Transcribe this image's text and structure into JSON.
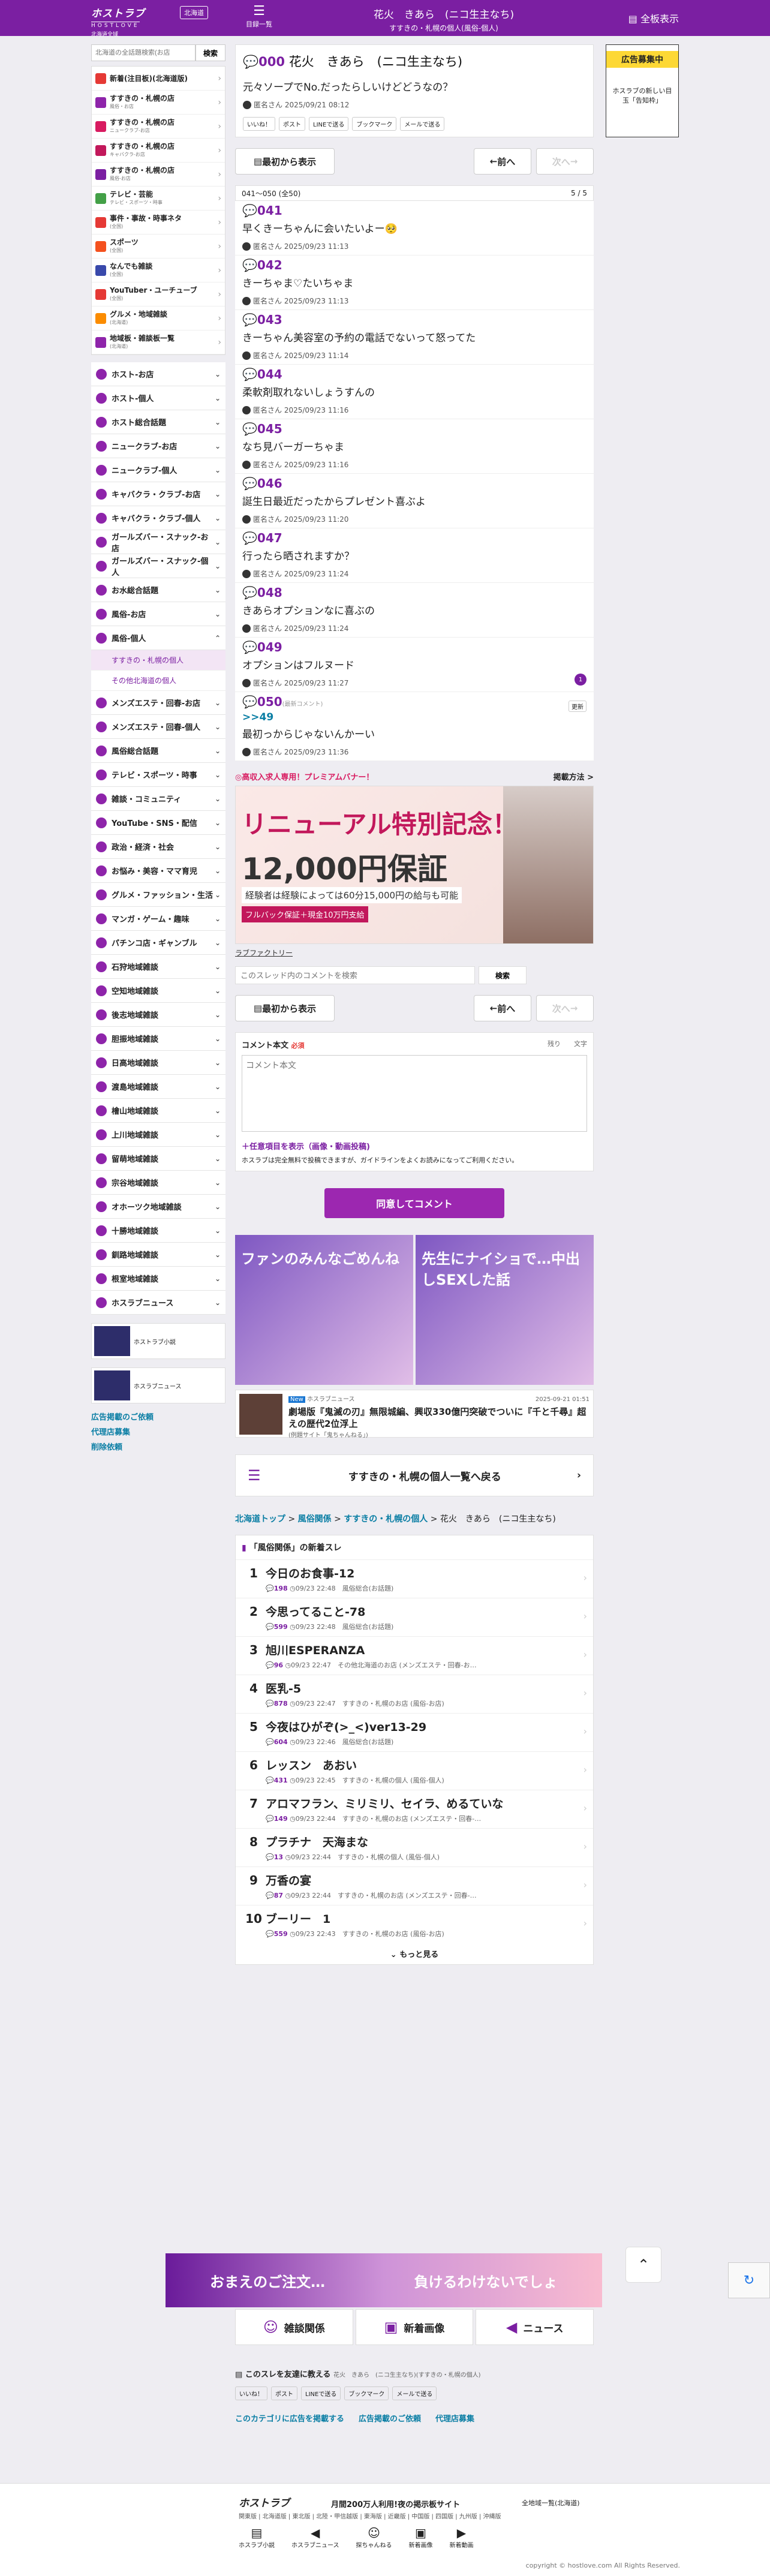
{
  "header": {
    "logo_main": "ホストラブ",
    "logo_sub": "HOSTLOVE",
    "logo_region": "北海道全域",
    "region_button": "北海道",
    "board_list": "目録一覧",
    "title": "花火　きあら　(ニコ生主なち)",
    "subtitle": "すすきの・札幌の個人(風俗-個人)",
    "all_show": "全板表示"
  },
  "sidebar": {
    "search_placeholder": "北海道の全話題検索(お店",
    "search_button": "検索",
    "categories": [
      {
        "label": "新着(注目板)(北海道版)",
        "sub": "",
        "color": "#e53935"
      },
      {
        "label": "すすきの・札幌の店",
        "sub": "風俗・お店",
        "color": "#8e24aa"
      },
      {
        "label": "すすきの・札幌の店",
        "sub": "ニュークラブ-お店",
        "color": "#d81b60"
      },
      {
        "label": "すすきの・札幌の店",
        "sub": "キャバクラ-お店",
        "color": "#c2185b"
      },
      {
        "label": "すすきの・札幌の店",
        "sub": "風俗-お店",
        "color": "#7b1fa2"
      },
      {
        "label": "テレビ・芸能",
        "sub": "テレビ・スポーツ・時事",
        "color": "#43a047"
      },
      {
        "label": "事件・事故・時事ネタ",
        "sub": "(全国)",
        "color": "#e53935"
      },
      {
        "label": "スポーツ",
        "sub": "(全国)",
        "color": "#f4511e"
      },
      {
        "label": "なんでも雑談",
        "sub": "(全国)",
        "color": "#3949ab"
      },
      {
        "label": "YouTuber・ユーチューブ",
        "sub": "(全国)",
        "color": "#e53935"
      },
      {
        "label": "グルメ・地域雑談",
        "sub": "(北海道)",
        "color": "#fb8c00"
      },
      {
        "label": "地域板・雑談板一覧",
        "sub": "(北海道)",
        "color": "#8e24aa"
      }
    ],
    "nav": [
      {
        "label": "ホスト-お店",
        "count": "⌄"
      },
      {
        "label": "ホスト-個人",
        "count": "⌄"
      },
      {
        "label": "ホスト総合話題",
        "count": "⌄"
      },
      {
        "label": "ニュークラブ-お店",
        "count": "⌄"
      },
      {
        "label": "ニュークラブ-個人",
        "count": "⌄"
      },
      {
        "label": "キャバクラ・クラブ-お店",
        "count": "⌄"
      },
      {
        "label": "キャバクラ・クラブ-個人",
        "count": "⌄"
      },
      {
        "label": "ガールズバー・スナック-お店",
        "count": "⌄"
      },
      {
        "label": "ガールズバー・スナック-個人",
        "count": "⌄"
      },
      {
        "label": "お水総合話題",
        "count": "⌄"
      },
      {
        "label": "風俗-お店",
        "count": "⌄"
      },
      {
        "label": "風俗-個人",
        "count": "⌃"
      }
    ],
    "nav_sub": [
      "すすきの・札幌の個人",
      "その他北海道の個人"
    ],
    "nav2": [
      {
        "label": "メンズエステ・回春-お店",
        "count": "⌄"
      },
      {
        "label": "メンズエステ・回春-個人",
        "count": "⌄"
      },
      {
        "label": "風俗総合話題",
        "count": "⌄"
      },
      {
        "label": "テレビ・スポーツ・時事",
        "count": "⌄"
      },
      {
        "label": "雑談・コミュニティ",
        "count": "⌄"
      },
      {
        "label": "YouTube・SNS・配信",
        "count": "⌄"
      },
      {
        "label": "政治・経済・社会",
        "count": "⌄"
      },
      {
        "label": "お悩み・美容・ママ育児",
        "count": "⌄"
      },
      {
        "label": "グルメ・ファッション・生活",
        "count": "⌄"
      },
      {
        "label": "マンガ・ゲーム・趣味",
        "count": "⌄"
      },
      {
        "label": "パチンコ店・ギャンブル",
        "count": "⌄"
      },
      {
        "label": "石狩地域雑談",
        "count": "⌄"
      },
      {
        "label": "空知地域雑談",
        "count": "⌄"
      },
      {
        "label": "後志地域雑談",
        "count": "⌄"
      },
      {
        "label": "胆振地域雑談",
        "count": "⌄"
      },
      {
        "label": "日高地域雑談",
        "count": "⌄"
      },
      {
        "label": "渡島地域雑談",
        "count": "⌄"
      },
      {
        "label": "檜山地域雑談",
        "count": "⌄"
      },
      {
        "label": "上川地域雑談",
        "count": "⌄"
      },
      {
        "label": "留萌地域雑談",
        "count": "⌄"
      },
      {
        "label": "宗谷地域雑談",
        "count": "⌄"
      },
      {
        "label": "オホーツク地域雑談",
        "count": "⌄"
      },
      {
        "label": "十勝地域雑談",
        "count": "⌄"
      },
      {
        "label": "釧路地域雑談",
        "count": "⌄"
      },
      {
        "label": "根室地域雑談",
        "count": "⌄"
      },
      {
        "label": "ホスラブニュース",
        "count": "⌄"
      }
    ],
    "banner1": "ホストラブ小説",
    "banner2": "ホスラブニュース",
    "links": [
      "広告掲載のご依頼",
      "代理店募集",
      "削除依頼"
    ]
  },
  "right_ad": {
    "head": "広告募集中",
    "body": "ホスラブの新しい目玉「告知枠」"
  },
  "op": {
    "num": "000",
    "title": "花火　きあら　(ニコ生主なち)",
    "body": "元々ソープでNo.だったらしいけどどうなの？",
    "author": "匿名さん",
    "date": "2025/09/21 08:12",
    "share": [
      "いいね！",
      "ポスト",
      "LINEで送る",
      "ブックマーク",
      "メールで送る"
    ]
  },
  "nav_top": {
    "first": "最初から表示",
    "prev": "前へ",
    "next": "次へ"
  },
  "pager": {
    "range": "041～050 (全50)",
    "page": "5 / 5"
  },
  "posts": [
    {
      "num": "041",
      "body": "早くきーちゃんに会いたいよー🥺",
      "author": "匿名さん",
      "date": "2025/09/23 11:13"
    },
    {
      "num": "042",
      "body": "きーちゃま♡たいちゃま",
      "author": "匿名さん",
      "date": "2025/09/23 11:13"
    },
    {
      "num": "043",
      "body": "きーちゃん美容室の予約の電話でないって怒ってた",
      "author": "匿名さん",
      "date": "2025/09/23 11:14"
    },
    {
      "num": "044",
      "body": "柔軟剤取れないしょうすんの",
      "author": "匿名さん",
      "date": "2025/09/23 11:16"
    },
    {
      "num": "045",
      "body": "なち見バーガーちゃま",
      "author": "匿名さん",
      "date": "2025/09/23 11:16"
    },
    {
      "num": "046",
      "body": "誕生日最近だったからプレゼント喜ぶよ",
      "author": "匿名さん",
      "date": "2025/09/23 11:20"
    },
    {
      "num": "047",
      "body": "行ったら晒されますか？",
      "author": "匿名さん",
      "date": "2025/09/23 11:24"
    },
    {
      "num": "048",
      "body": "きあらオプションなに喜ぶの",
      "author": "匿名さん",
      "date": "2025/09/23 11:24"
    },
    {
      "num": "049",
      "body": "オプションはフルヌード",
      "author": "匿名さん",
      "date": "2025/09/23 11:27"
    },
    {
      "num": "050",
      "note": "(最新コメント)",
      "link": ">>49",
      "body": "最初っからじゃないんかーい",
      "author": "匿名さん",
      "date": "2025/09/23 11:36"
    }
  ],
  "reply_count": "1",
  "update_badge": "更新",
  "premium": {
    "label": "◎高収入求人専用！プレミアムバナー！",
    "method": "掲載方法 >",
    "ad_1": "リニューアル特別記念！",
    "ad_2": "12,000円保証",
    "ad_3": "経験者は経験によっては60分15,000円の給与も可能",
    "ad_4": "フルバック保証＋現金10万円支給",
    "link": "ラブファクトリー"
  },
  "thread_search": {
    "placeholder": "このスレッド内のコメントを検索",
    "button": "検索"
  },
  "comment_form": {
    "label": "コメント本文",
    "required": "必須",
    "remain": "残り　　文字",
    "placeholder": "コメント本文",
    "option": "任意項目を表示（画像・動画投稿)",
    "rule": "ホスラブは完全無料で投稿できますが、ガイドラインをよくお読みになってご利用ください。",
    "submit": "同意してコメント"
  },
  "bigad": {
    "left": "ファンのみんなごめんね",
    "right": "先生にナイショで…中出しSEXした話"
  },
  "news": {
    "tag": "New",
    "source": "ホスラブニュース",
    "date": "2025-09-21 01:51",
    "title": "劇場版『鬼滅の刃』無限城編、興収330億円突破でついに『千と千尋』超えの歴代2位浮上",
    "sub": "(例題サイト「鬼ちゃんねる」)"
  },
  "to_board": "すすきの・札幌の個人一覧へ戻る",
  "breadcrumb": {
    "a1": "北海道トップ",
    "a2": "風俗関係",
    "a3": "すすきの・札幌の個人",
    "current": "花火　きあら　(ニコ生主なち)"
  },
  "new_threads": {
    "header": "「風俗関係」の新着スレ",
    "items": [
      {
        "rank": "1",
        "title": "今日のお食事-12",
        "count": "198",
        "time": "09/23 22:48",
        "board": "風俗総合(お話題)"
      },
      {
        "rank": "2",
        "title": "今思ってること-78",
        "count": "599",
        "time": "09/23 22:48",
        "board": "風俗総合(お話題)"
      },
      {
        "rank": "3",
        "title": "旭川ESPERANZA",
        "count": "96",
        "time": "09/23 22:47",
        "board": "その他北海道のお店 (メンズエステ・回春-お…"
      },
      {
        "rank": "4",
        "title": "医乳-5",
        "count": "878",
        "time": "09/23 22:47",
        "board": "すすきの・札幌のお店 (風俗-お店)"
      },
      {
        "rank": "5",
        "title": "今夜はひがぞ(>_<)ver13-29",
        "count": "604",
        "time": "09/23 22:46",
        "board": "風俗総合(お話題)"
      },
      {
        "rank": "6",
        "title": "レッスン　あおい",
        "count": "431",
        "time": "09/23 22:45",
        "board": "すすきの・札幌の個人 (風俗-個人)"
      },
      {
        "rank": "7",
        "title": "アロマフラン、ミリミリ、セイラ、めるていな",
        "count": "149",
        "time": "09/23 22:44",
        "board": "すすきの・札幌のお店 (メンズエステ・回春-…"
      },
      {
        "rank": "8",
        "title": "プラチナ　天海まな",
        "count": "13",
        "time": "09/23 22:44",
        "board": "すすきの・札幌の個人 (風俗-個人)"
      },
      {
        "rank": "9",
        "title": "万香の宴",
        "count": "87",
        "time": "09/23 22:44",
        "board": "すすきの・札幌のお店 (メンズエステ・回春-…"
      },
      {
        "rank": "10",
        "title": "ブーリー　1",
        "count": "559",
        "time": "09/23 22:43",
        "board": "すすきの・札幌のお店 (風俗-お店)"
      }
    ],
    "more": "もっと見る"
  },
  "bottom_ad": {
    "left": "おまえのご注文…",
    "right": "負けるわけないでしょ"
  },
  "bottom_nav": [
    "雑談関係",
    "新着画像",
    "ニュース"
  ],
  "share_bar": {
    "title": "このスレを友達に教える",
    "sub": "花火　きあら　(ニコ生主なち)(すすきの・札幌の個人)",
    "links": [
      "このカテゴリに広告を掲載する",
      "広告掲載のご依頼",
      "代理店募集"
    ]
  },
  "footer": {
    "logo": "ホストラブ",
    "tagline": "月間200万人利用!夜の掲示板サイト",
    "list": "全地域一覧(北海道)",
    "regions": "関東版 | 北海道版 | 東北版 | 北陸・甲信越版 | 東海版 | 近畿版 | 中国版 | 四国版 | 九州版 | 沖縄版",
    "nav": [
      "ホスラブ小説",
      "ホスラブニュース",
      "探ちゃんねる",
      "新着画像",
      "新着動画"
    ],
    "copyright": "copyright © hostlove.com All Rights Reserved."
  }
}
